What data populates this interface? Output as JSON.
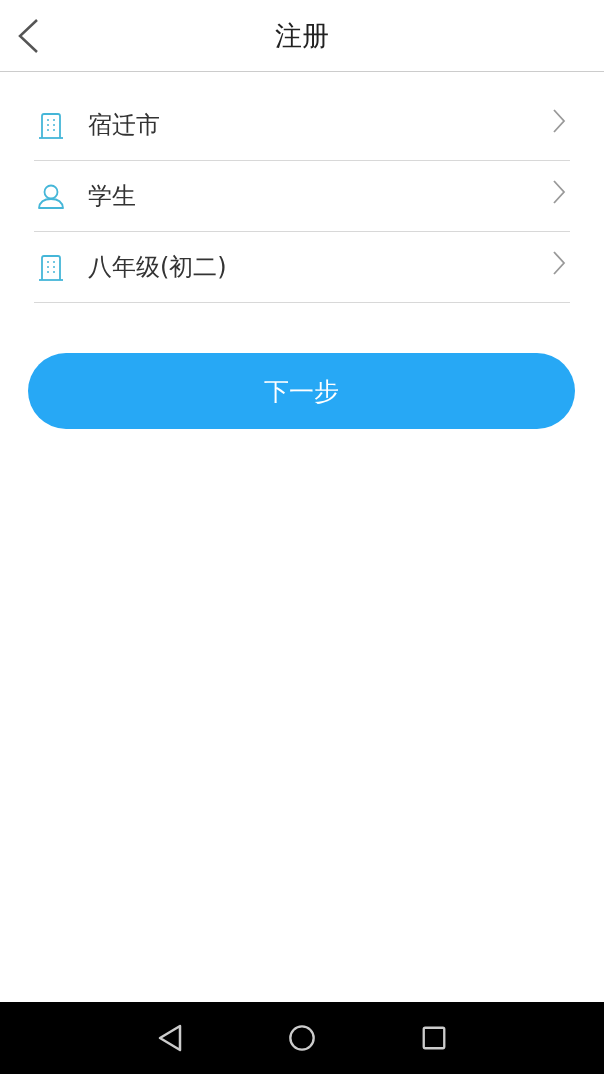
{
  "header": {
    "title": "注册"
  },
  "options": [
    {
      "kind": "building",
      "label": "宿迁市"
    },
    {
      "kind": "person",
      "label": "学生"
    },
    {
      "kind": "building",
      "label": "八年级(初二)"
    }
  ],
  "next_button": {
    "label": "下一步"
  }
}
